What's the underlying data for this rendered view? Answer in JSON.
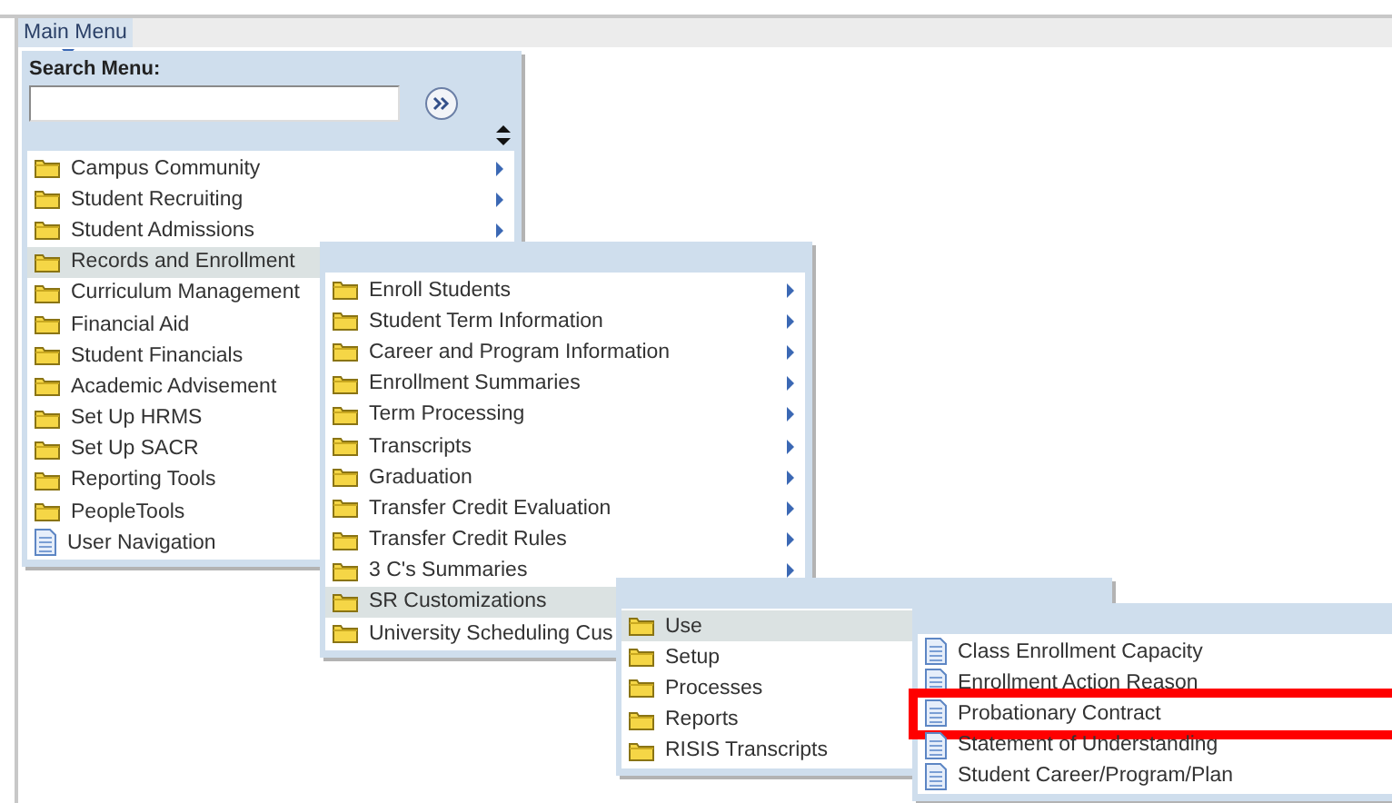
{
  "top_bar": {
    "tab": "Main Menu"
  },
  "search_label": "Search Menu:",
  "menus": [
    {
      "items": [
        {
          "label": "Campus Community",
          "kind": "folder",
          "selected": false,
          "arrow": true
        },
        {
          "label": "Student Recruiting",
          "kind": "folder",
          "selected": false,
          "arrow": true
        },
        {
          "label": "Student Admissions",
          "kind": "folder",
          "selected": false,
          "arrow": true
        },
        {
          "label": "Records and Enrollment",
          "kind": "folder",
          "selected": true,
          "arrow": false
        },
        {
          "label": "Curriculum Management",
          "kind": "folder",
          "selected": false,
          "arrow": false
        },
        {
          "label": "Financial Aid",
          "kind": "folder",
          "selected": false,
          "arrow": false
        },
        {
          "label": "Student Financials",
          "kind": "folder",
          "selected": false,
          "arrow": false
        },
        {
          "label": "Academic Advisement",
          "kind": "folder",
          "selected": false,
          "arrow": false
        },
        {
          "label": "Set Up HRMS",
          "kind": "folder",
          "selected": false,
          "arrow": false
        },
        {
          "label": "Set Up SACR",
          "kind": "folder",
          "selected": false,
          "arrow": false
        },
        {
          "label": "Reporting Tools",
          "kind": "folder",
          "selected": false,
          "arrow": false
        },
        {
          "label": "PeopleTools",
          "kind": "folder",
          "selected": false,
          "arrow": false
        },
        {
          "label": "User Navigation",
          "kind": "page",
          "selected": false,
          "arrow": false
        }
      ]
    },
    {
      "items": [
        {
          "label": "Enroll Students",
          "kind": "folder",
          "selected": false,
          "arrow": true
        },
        {
          "label": "Student Term Information",
          "kind": "folder",
          "selected": false,
          "arrow": true
        },
        {
          "label": "Career and Program Information",
          "kind": "folder",
          "selected": false,
          "arrow": true
        },
        {
          "label": "Enrollment Summaries",
          "kind": "folder",
          "selected": false,
          "arrow": true
        },
        {
          "label": "Term Processing",
          "kind": "folder",
          "selected": false,
          "arrow": true
        },
        {
          "label": "Transcripts",
          "kind": "folder",
          "selected": false,
          "arrow": true
        },
        {
          "label": "Graduation",
          "kind": "folder",
          "selected": false,
          "arrow": true
        },
        {
          "label": "Transfer Credit Evaluation",
          "kind": "folder",
          "selected": false,
          "arrow": true
        },
        {
          "label": "Transfer Credit Rules",
          "kind": "folder",
          "selected": false,
          "arrow": true
        },
        {
          "label": "3 C's Summaries",
          "kind": "folder",
          "selected": false,
          "arrow": true
        },
        {
          "label": "SR Customizations",
          "kind": "folder",
          "selected": true,
          "arrow": false
        },
        {
          "label": "University Scheduling Cus",
          "kind": "folder",
          "selected": false,
          "arrow": false
        }
      ]
    },
    {
      "items": [
        {
          "label": "Use",
          "kind": "folder",
          "selected": true,
          "arrow": false
        },
        {
          "label": "Setup",
          "kind": "folder",
          "selected": false,
          "arrow": false
        },
        {
          "label": "Processes",
          "kind": "folder",
          "selected": false,
          "arrow": false
        },
        {
          "label": "Reports",
          "kind": "folder",
          "selected": false,
          "arrow": false
        },
        {
          "label": "RISIS Transcripts",
          "kind": "folder",
          "selected": false,
          "arrow": false
        }
      ]
    },
    {
      "items": [
        {
          "label": "Class Enrollment Capacity",
          "kind": "page",
          "selected": false,
          "arrow": false,
          "highlighted": false
        },
        {
          "label": "Enrollment Action Reason",
          "kind": "page",
          "selected": false,
          "arrow": false,
          "highlighted": false
        },
        {
          "label": "Probationary Contract",
          "kind": "page",
          "selected": false,
          "arrow": false,
          "highlighted": true
        },
        {
          "label": "Statement of Understanding",
          "kind": "page",
          "selected": false,
          "arrow": false,
          "highlighted": false
        },
        {
          "label": "Student Career/Program/Plan",
          "kind": "page",
          "selected": false,
          "arrow": false,
          "highlighted": false
        }
      ]
    }
  ]
}
